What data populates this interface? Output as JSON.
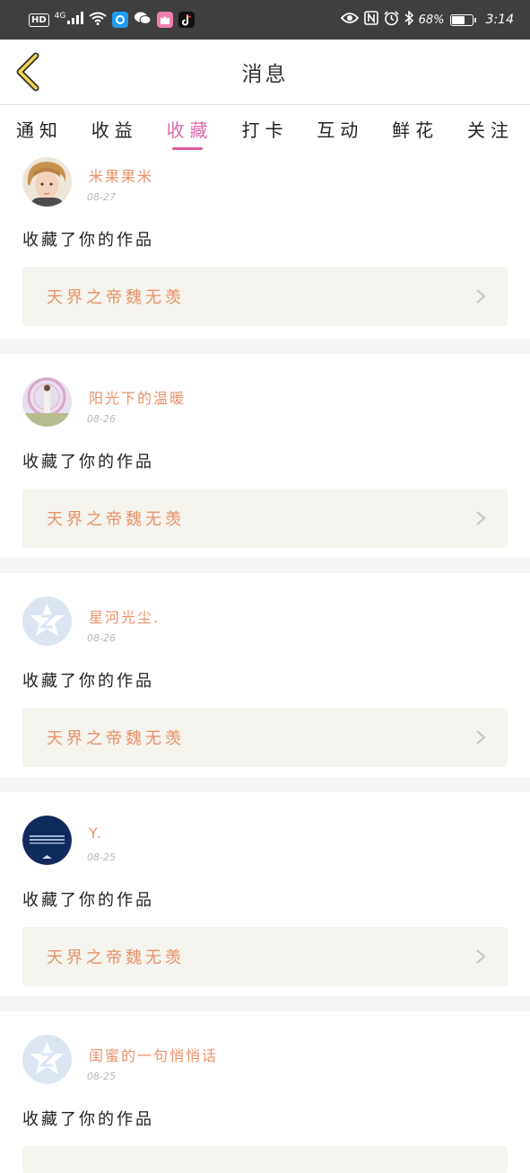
{
  "status_bar": {
    "hd": "HD",
    "network": "4G",
    "battery_percent": "68%",
    "battery_level": 0.68,
    "time": "3:14",
    "icons": [
      "hd-icon",
      "signal-icon",
      "wifi-icon",
      "browser-app-icon",
      "wechat-icon",
      "cat-app-icon",
      "tiktok-icon",
      "eye-icon",
      "nfc-icon",
      "alarm-icon",
      "bluetooth-icon",
      "battery-icon"
    ]
  },
  "header": {
    "title": "消息",
    "back_icon": "chevron-left-icon"
  },
  "tabs": [
    {
      "label": "通知",
      "active": false
    },
    {
      "label": "收益",
      "active": false
    },
    {
      "label": "收藏",
      "active": true
    },
    {
      "label": "打卡",
      "active": false
    },
    {
      "label": "互动",
      "active": false
    },
    {
      "label": "鲜花",
      "active": false
    },
    {
      "label": "关注",
      "active": false
    }
  ],
  "messages": [
    {
      "username": "米果果米",
      "date": "08-27",
      "action": "收藏了你的作品",
      "work_title": "天界之帝魏无羡",
      "avatar": "photo-avatar"
    },
    {
      "username": "阳光下的温暖",
      "date": "08-26",
      "action": "收藏了你的作品",
      "work_title": "天界之帝魏无羡",
      "avatar": "photo-avatar"
    },
    {
      "username": "星河光尘.",
      "date": "08-26",
      "action": "收藏了你的作品",
      "work_title": "天界之帝魏无羡",
      "avatar": "default-avatar"
    },
    {
      "username": "Y.",
      "date": "08-25",
      "action": "收藏了你的作品",
      "work_title": "天界之帝魏无羡",
      "avatar": "dark-avatar"
    },
    {
      "username": "闺蜜的一句悄悄话",
      "date": "08-25",
      "action": "收藏了你的作品",
      "work_title": "",
      "avatar": "default-avatar"
    }
  ],
  "colors": {
    "accent": "#e05a9f",
    "username": "#e8926a",
    "work_bg": "#f5f4ee",
    "back_arrow": "#f2d54a"
  }
}
